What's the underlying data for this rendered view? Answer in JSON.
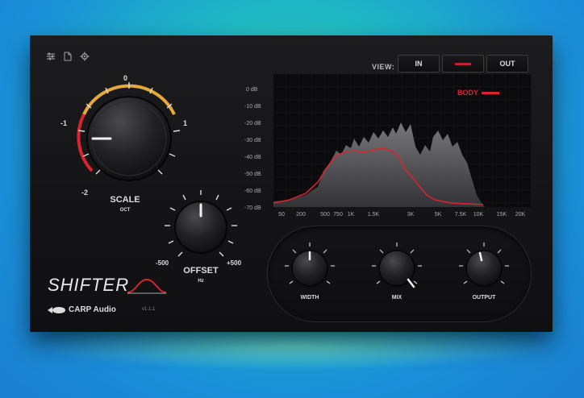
{
  "plugin": {
    "name": "SHIFTER",
    "company": "CARP Audio",
    "version": "v1.1.1",
    "toolbar_icons": [
      "sliders-icon",
      "file-icon",
      "gear-icon"
    ]
  },
  "view": {
    "label": "VIEW:",
    "buttons": [
      {
        "label": "IN"
      },
      {
        "label": ""
      },
      {
        "label": "OUT"
      }
    ]
  },
  "analyzer": {
    "legend": "BODY",
    "db_labels": [
      "0 dB",
      "-10 dB",
      "-20 dB",
      "-30 dB",
      "-40 dB",
      "-50 dB",
      "-60 dB",
      "-70 dB"
    ],
    "freq_labels": [
      "50",
      "200",
      "500",
      "750",
      "1K",
      "1.5K",
      "3K",
      "5K",
      "7.5K",
      "10K",
      "15K",
      "20K"
    ]
  },
  "knobs": {
    "scale": {
      "label": "SCALE",
      "unit": "OCT",
      "tick_min": "-2",
      "tick_neg1": "-1",
      "tick_zero": "0",
      "tick_max": "1"
    },
    "offset": {
      "label": "OFFSET",
      "unit": "Hz",
      "tick_min": "-500",
      "tick_max": "+500"
    },
    "width": {
      "label": "WIDTH"
    },
    "mix": {
      "label": "MIX"
    },
    "output": {
      "label": "OUTPUT"
    }
  },
  "colors": {
    "accent_red": "#d8242e",
    "accent_yellow": "#e6a83a"
  }
}
